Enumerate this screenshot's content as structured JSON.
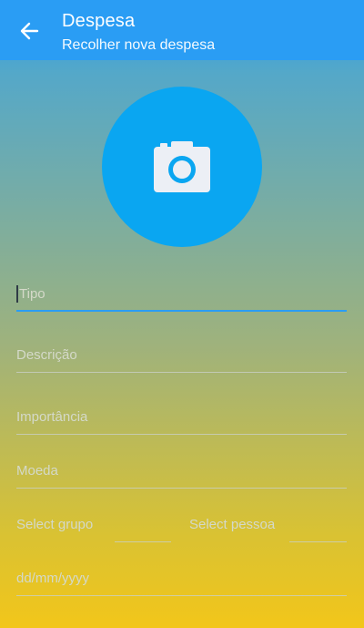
{
  "app_bar": {
    "title": "Despesa",
    "subtitle": "Recolher nova despesa",
    "back_icon": "arrow-left-icon",
    "color": "#2a9df4"
  },
  "photo": {
    "icon": "camera-icon",
    "color": "#0aa6f1"
  },
  "form": {
    "tipo_placeholder": "Tipo",
    "descricao_placeholder": "Descrição",
    "importancia_placeholder": "Importância",
    "moeda_placeholder": "Moeda",
    "grupo_placeholder": "Select grupo",
    "pessoa_placeholder": "Select pessoa",
    "date_placeholder": "dd/mm/yyyy"
  }
}
